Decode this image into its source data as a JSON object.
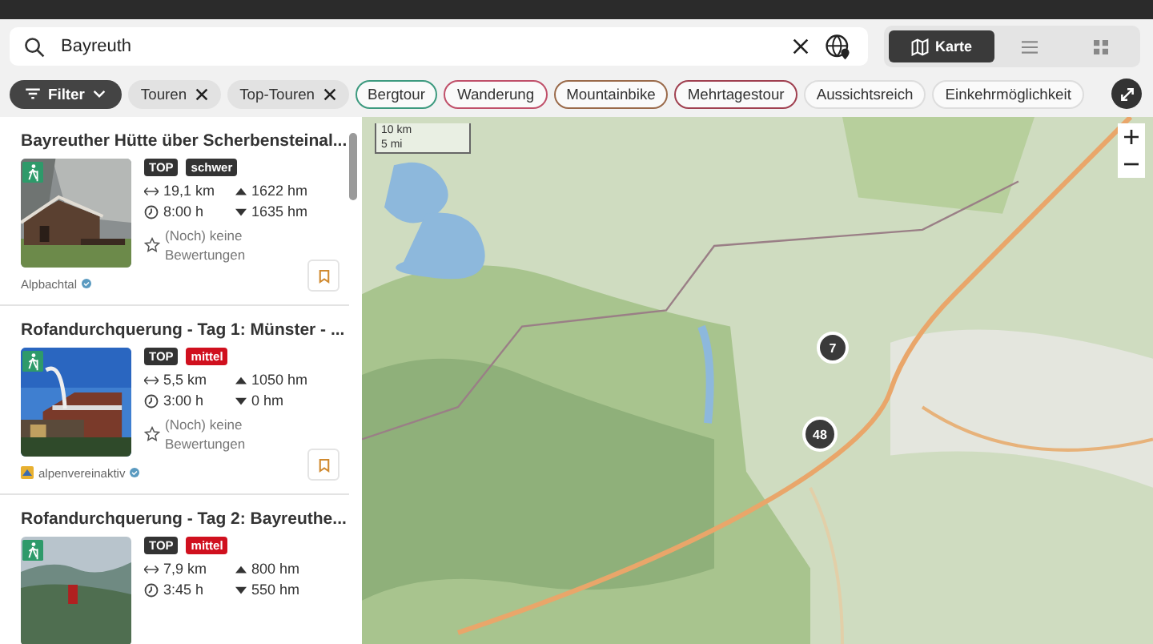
{
  "search": {
    "value": "Bayreuth"
  },
  "view_toggle": [
    {
      "kind": "map",
      "label": "Karte",
      "selected": true
    },
    {
      "kind": "list",
      "selected": false
    },
    {
      "kind": "grid",
      "selected": false
    }
  ],
  "filter_chips": [
    {
      "kind": "filter",
      "label": "Filter"
    },
    {
      "kind": "removable",
      "label": "Touren"
    },
    {
      "kind": "removable",
      "label": "Top-Touren"
    },
    {
      "kind": "tag",
      "label": "Bergtour",
      "color": "#3d9a7f"
    },
    {
      "kind": "tag",
      "label": "Wanderung",
      "color": "#c0506a"
    },
    {
      "kind": "tag",
      "label": "Mountainbike",
      "color": "#9a6a4a"
    },
    {
      "kind": "tag",
      "label": "Mehrtagestour",
      "color": "#a04050"
    },
    {
      "kind": "tag",
      "label": "Aussichtsreich",
      "color": "#dddddd"
    },
    {
      "kind": "tag",
      "label": "Einkehrmöglichkeit",
      "color": "#dddddd"
    }
  ],
  "tours": [
    {
      "title": "Bayreuther Hütte über Scherbensteinal...",
      "badges": [
        {
          "label": "TOP",
          "color": "#333333"
        },
        {
          "label": "schwer",
          "color": "#333333"
        }
      ],
      "distance": "19,1 km",
      "ascent": "1622 hm",
      "duration": "8:00 h",
      "descent": "1635 hm",
      "rating": "(Noch) keine Bewertungen",
      "source": "Alpbachtal",
      "source_logo": false
    },
    {
      "title": "Rofandurchquerung - Tag 1: Münster - ...",
      "badges": [
        {
          "label": "TOP",
          "color": "#333333"
        },
        {
          "label": "mittel",
          "color": "#d0101e"
        }
      ],
      "distance": "5,5 km",
      "ascent": "1050 hm",
      "duration": "3:00 h",
      "descent": "0 hm",
      "rating": "(Noch) keine Bewertungen",
      "source": "alpenvereinaktiv",
      "source_logo": true
    },
    {
      "title": "Rofandurchquerung - Tag 2: Bayreuthe...",
      "badges": [
        {
          "label": "TOP",
          "color": "#333333"
        },
        {
          "label": "mittel",
          "color": "#d0101e"
        }
      ],
      "distance": "7,9 km",
      "ascent": "800 hm",
      "duration": "3:45 h",
      "descent": "550 hm"
    }
  ],
  "map": {
    "scale": [
      "10 km",
      "5 mi"
    ],
    "clusters": [
      {
        "count": "7"
      },
      {
        "count": "48"
      }
    ]
  }
}
